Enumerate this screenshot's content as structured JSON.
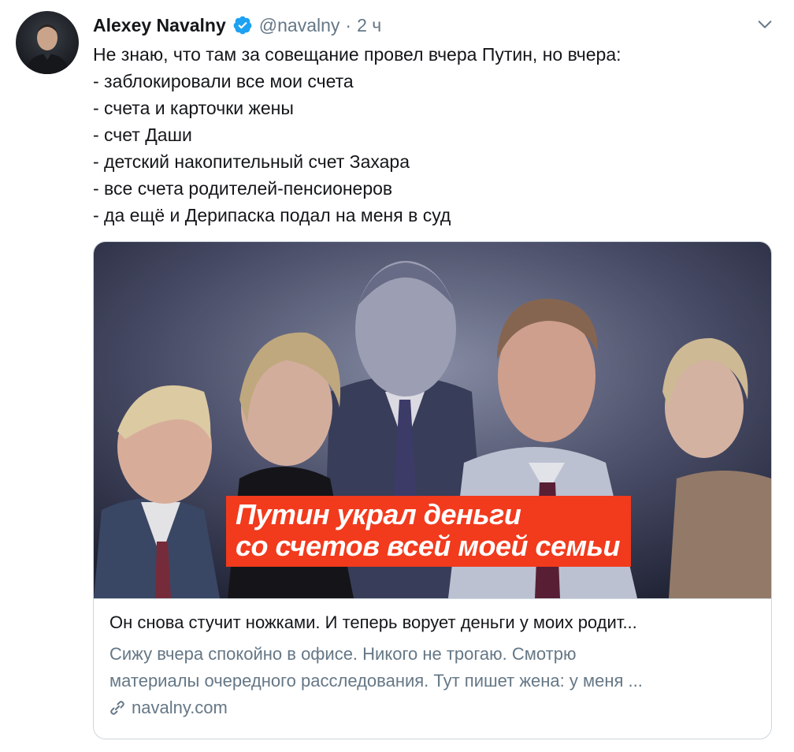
{
  "author": {
    "name": "Alexey Navalny",
    "handle": "@navalny",
    "separator": "·",
    "time": "2 ч"
  },
  "icons": {
    "avatar": "avatar-photo",
    "verified": "verified-badge-icon",
    "menu": "chevron-down-icon",
    "link": "link-icon"
  },
  "colors": {
    "verified": "#1da1f2",
    "secondary_text": "#657786",
    "banner": "#f23a1d"
  },
  "tweet": {
    "lines": [
      "Не знаю, что там за совещание провел вчера Путин, но вчера:",
      "- заблокировали все мои счета",
      "- счета и карточки жены",
      "- счет Даши",
      "- детский накопительный счет Захара",
      "- все счета родителей-пенсионеров",
      "- да ещё и Дерипаска подал на меня в суд"
    ]
  },
  "card": {
    "image_text": {
      "line1": "Путин украл деньги",
      "line2": "со счетов всей моей семьи"
    },
    "title": "Он снова стучит ножками. И теперь ворует деньги у моих родит...",
    "description": [
      "Сижу вчера спокойно в офисе. Никого не трогаю. Смотрю",
      "материалы очередного расследования. Тут пишет жена: у меня ..."
    ],
    "domain": "navalny.com"
  }
}
